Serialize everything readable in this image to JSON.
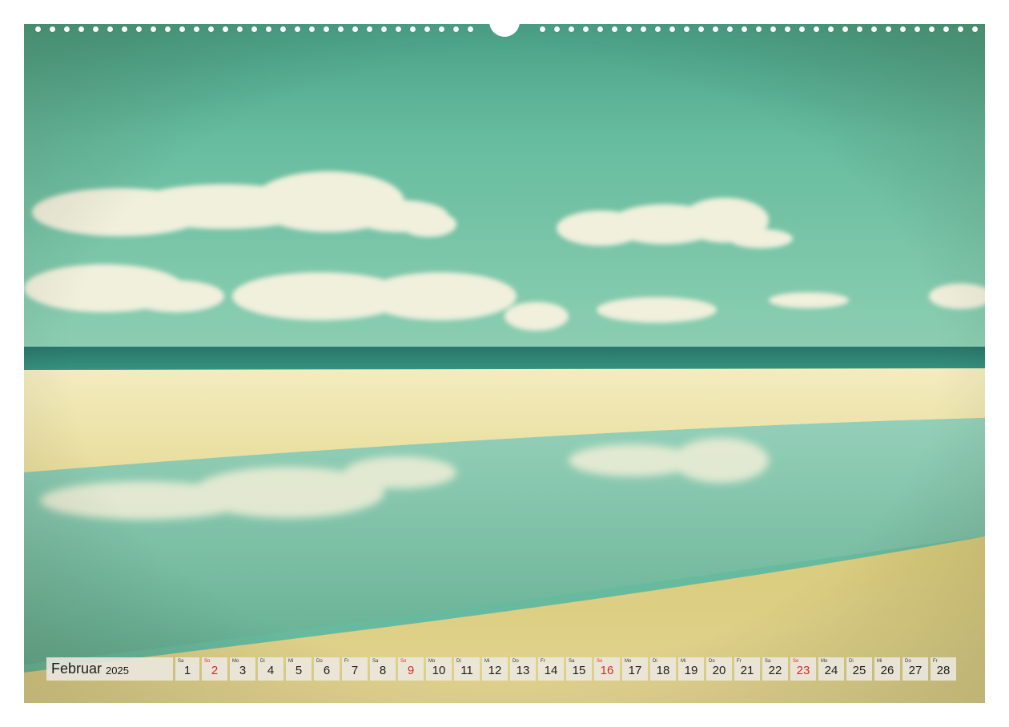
{
  "calendar": {
    "month": "Februar",
    "year": "2025",
    "days": [
      {
        "weekday": "Sa",
        "day": "1",
        "sunday": false
      },
      {
        "weekday": "So",
        "day": "2",
        "sunday": true
      },
      {
        "weekday": "Mo",
        "day": "3",
        "sunday": false
      },
      {
        "weekday": "Di",
        "day": "4",
        "sunday": false
      },
      {
        "weekday": "Mi",
        "day": "5",
        "sunday": false
      },
      {
        "weekday": "Do",
        "day": "6",
        "sunday": false
      },
      {
        "weekday": "Fr",
        "day": "7",
        "sunday": false
      },
      {
        "weekday": "Sa",
        "day": "8",
        "sunday": false
      },
      {
        "weekday": "So",
        "day": "9",
        "sunday": true
      },
      {
        "weekday": "Mo",
        "day": "10",
        "sunday": false
      },
      {
        "weekday": "Di",
        "day": "11",
        "sunday": false
      },
      {
        "weekday": "Mi",
        "day": "12",
        "sunday": false
      },
      {
        "weekday": "Do",
        "day": "13",
        "sunday": false
      },
      {
        "weekday": "Fr",
        "day": "14",
        "sunday": false
      },
      {
        "weekday": "Sa",
        "day": "15",
        "sunday": false
      },
      {
        "weekday": "So",
        "day": "16",
        "sunday": true
      },
      {
        "weekday": "Mo",
        "day": "17",
        "sunday": false
      },
      {
        "weekday": "Di",
        "day": "18",
        "sunday": false
      },
      {
        "weekday": "Mi",
        "day": "19",
        "sunday": false
      },
      {
        "weekday": "Do",
        "day": "20",
        "sunday": false
      },
      {
        "weekday": "Fr",
        "day": "21",
        "sunday": false
      },
      {
        "weekday": "Sa",
        "day": "22",
        "sunday": false
      },
      {
        "weekday": "So",
        "day": "23",
        "sunday": true
      },
      {
        "weekday": "Mo",
        "day": "24",
        "sunday": false
      },
      {
        "weekday": "Di",
        "day": "25",
        "sunday": false
      },
      {
        "weekday": "Mi",
        "day": "26",
        "sunday": false
      },
      {
        "weekday": "Do",
        "day": "27",
        "sunday": false
      },
      {
        "weekday": "Fr",
        "day": "28",
        "sunday": false
      }
    ]
  },
  "colors": {
    "sunday": "#e0242a",
    "sky": "#5fb9a1",
    "sea": "#1f7f72",
    "sand": "#efe6a8",
    "cell_background": "#ece8e0"
  }
}
